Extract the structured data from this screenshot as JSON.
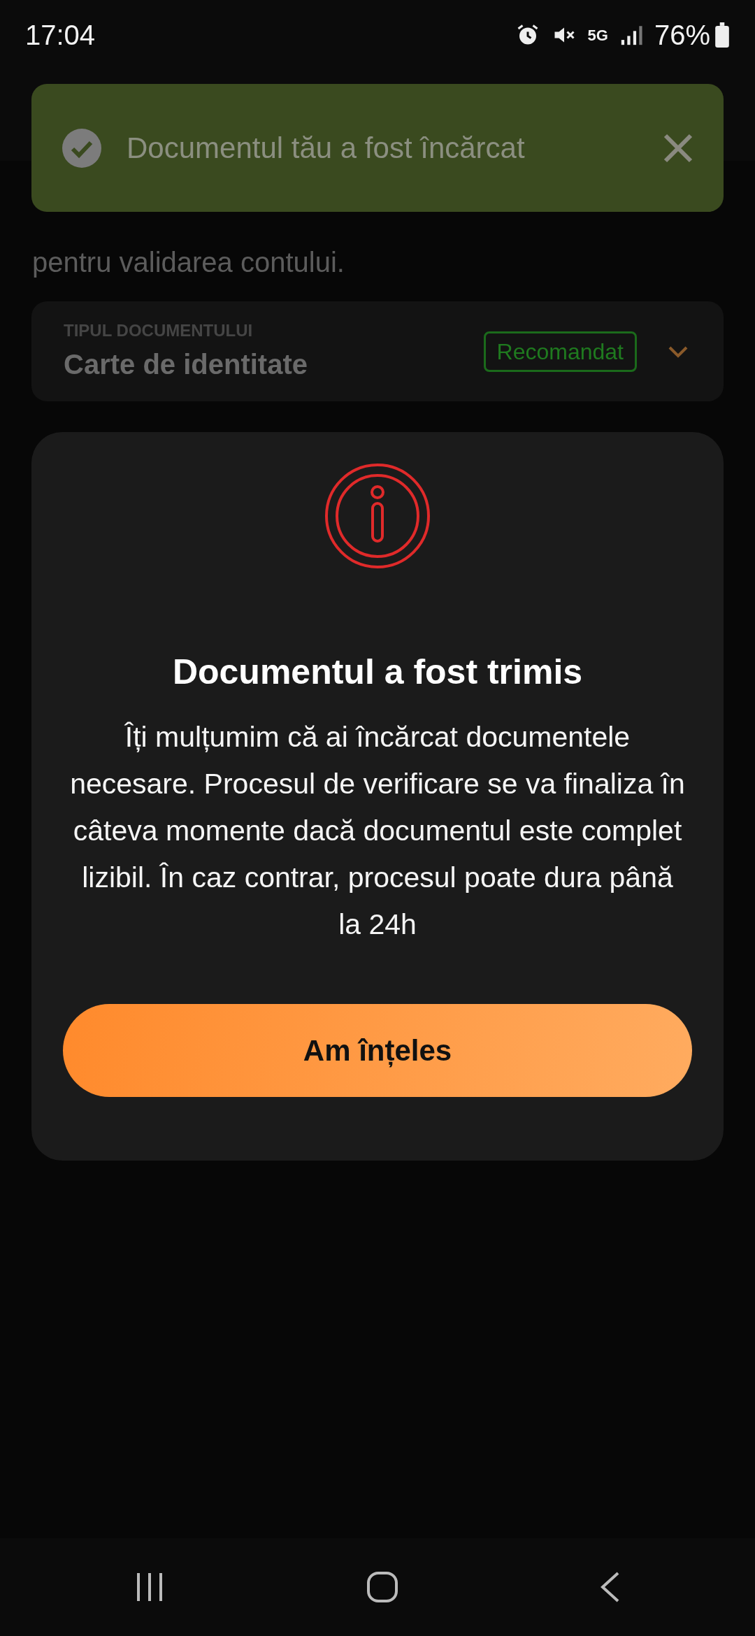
{
  "status_bar": {
    "time": "17:04",
    "network": "5G",
    "battery": "76%"
  },
  "toast": {
    "message": "Documentul tău a fost încărcat"
  },
  "intro": {
    "text": "pentru validarea contului."
  },
  "document_select": {
    "label": "TIPUL DOCUMENTULUI",
    "value": "Carte de identitate",
    "badge": "Recomandat"
  },
  "dialog": {
    "title": "Documentul a fost trimis",
    "message": "Îți mulțumim că ai încărcat documentele necesare. Procesul de verificare se va finaliza în câteva momente dacă documentul este complet lizibil. În caz contrar, procesul poate dura până la 24h",
    "button": "Am înțeles"
  }
}
